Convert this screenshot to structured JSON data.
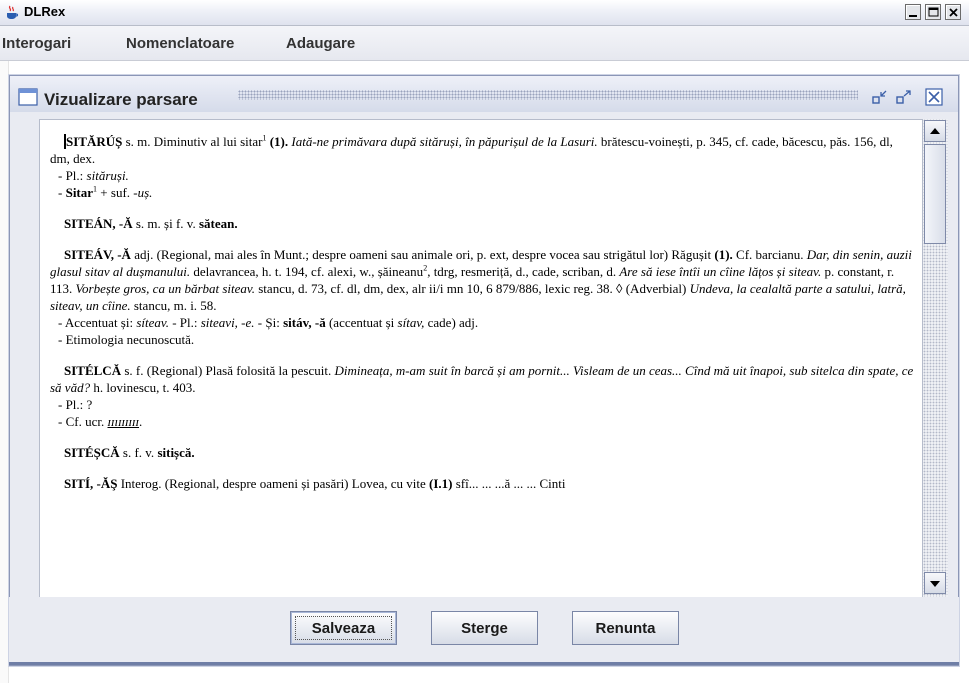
{
  "window": {
    "title": "DLRex"
  },
  "menu": [
    "Interogari",
    "Nomenclatoare",
    "Adaugare"
  ],
  "frame": {
    "title": "Vizualizare parsare"
  },
  "buttons": {
    "save": "Salveaza",
    "delete": "Sterge",
    "cancel": "Renunta"
  },
  "entries": [
    {
      "paragraphs": [
        [
          {
            "t": "SITĂRÚȘ",
            "s": "b"
          },
          {
            "t": " s. m. Diminutiv al lui sitar"
          },
          {
            "t": "1",
            "s": "sup"
          },
          {
            "t": " "
          },
          {
            "t": "(1).",
            "s": "b"
          },
          {
            "t": " Iată-ne primăvara după sităruși, în păpurișul de la Lasuri.",
            "s": "i"
          },
          {
            "t": " brătescu-voinești, p. 345, cf. cade, băcescu, păs. 156, dl, dm, dex."
          }
        ]
      ],
      "subs": [
        [
          {
            "t": "- Pl.: "
          },
          {
            "t": "sităruși.",
            "s": "i"
          }
        ],
        [
          {
            "t": "- "
          },
          {
            "t": "Sitar",
            "s": "b"
          },
          {
            "t": "1",
            "s": "sup"
          },
          {
            "t": " + suf. "
          },
          {
            "t": "-uș.",
            "s": "i"
          }
        ]
      ]
    },
    {
      "paragraphs": [
        [
          {
            "t": "SITEÁN, -Ă",
            "s": "b"
          },
          {
            "t": " s. m. și f. v. "
          },
          {
            "t": "sătean.",
            "s": "b"
          }
        ]
      ],
      "subs": []
    },
    {
      "paragraphs": [
        [
          {
            "t": "SITEÁV, -Ă",
            "s": "b"
          },
          {
            "t": " adj. (Regional, mai ales în Munt.; despre oameni sau animale ori, p. ext, despre vocea sau strigătul lor) Răgușit "
          },
          {
            "t": "(1).",
            "s": "b"
          },
          {
            "t": " Cf. barcianu. "
          },
          {
            "t": "Dar, din senin, auzii glasul sitav al dușmanului.",
            "s": "i"
          },
          {
            "t": " delavrancea, h. t. 194, cf. alexi, w., șăineanu"
          },
          {
            "t": "2",
            "s": "sup"
          },
          {
            "t": ", tdrg, resmeriță, d., cade, scriban, d. "
          },
          {
            "t": "Are să iese întîi un cîine lățos și siteav.",
            "s": "i"
          },
          {
            "t": " p. constant, r. 113. "
          },
          {
            "t": "Vorbește gros, ca un bărbat siteav.",
            "s": "i"
          },
          {
            "t": " stancu, d. 73, cf. dl, dm, dex, alr ii/i mn 10, 6 879/886, lexic reg. 38. ◊ (Adverbial) "
          },
          {
            "t": "Undeva, la cealaltă parte a satului, latră, siteav, un cîine.",
            "s": "i"
          },
          {
            "t": " stancu, m. i. 58."
          }
        ]
      ],
      "subs": [
        [
          {
            "t": "- Accentuat și: "
          },
          {
            "t": "síteav.",
            "s": "i"
          },
          {
            "t": " - Pl.: "
          },
          {
            "t": "siteavi, -e.",
            "s": "i"
          },
          {
            "t": " - Și: "
          },
          {
            "t": "sitáv, -ă",
            "s": "b"
          },
          {
            "t": " (accentuat și "
          },
          {
            "t": "sítav,",
            "s": "i"
          },
          {
            "t": " cade) adj."
          }
        ],
        [
          {
            "t": "- Etimologia necunoscută."
          }
        ]
      ]
    },
    {
      "paragraphs": [
        [
          {
            "t": "SITÉLCĂ",
            "s": "b"
          },
          {
            "t": " s. f. (Regional) Plasă folosită la pescuit. "
          },
          {
            "t": "Dimineața, m-am suit în barcă și am pornit... Visleam de un ceas... Cînd mă uit înapoi, sub sitelca din spate, ce să văd?",
            "s": "i"
          },
          {
            "t": " h. lovinescu, t. 403."
          }
        ]
      ],
      "subs": [
        [
          {
            "t": "- Pl.: ?"
          }
        ],
        [
          {
            "t": "- Cf. ucr. "
          },
          {
            "t": "ɪɪıɪɪɪɪɪɪ",
            "s": "u"
          },
          {
            "t": "."
          }
        ]
      ]
    },
    {
      "paragraphs": [
        [
          {
            "t": "SITÉȘCĂ",
            "s": "b"
          },
          {
            "t": " s. f. v. "
          },
          {
            "t": "sitișcă.",
            "s": "b"
          }
        ]
      ],
      "subs": []
    },
    {
      "paragraphs": [
        [
          {
            "t": "SITÍ, -ĂŞ",
            "s": "b"
          },
          {
            "t": " Interog. (Regional, despre oameni și pasări) Lovea, cu vite "
          },
          {
            "t": "(I.1)",
            "s": "b"
          },
          {
            "t": " sfî... ... ...ă ... ... Cinti"
          }
        ]
      ],
      "subs": []
    }
  ],
  "icons": [
    "java-cup-icon",
    "minimize-icon",
    "maximize-icon",
    "close-icon",
    "frame-icon",
    "iconify-icon",
    "frame-maximize-icon",
    "frame-close-icon",
    "scroll-up-icon",
    "scroll-down-icon"
  ]
}
